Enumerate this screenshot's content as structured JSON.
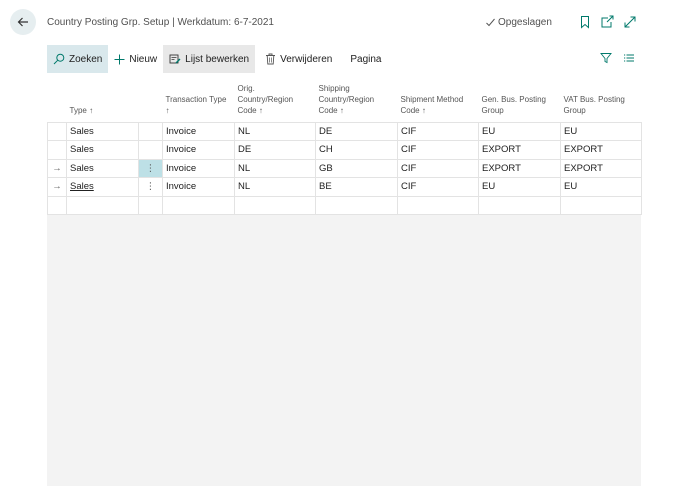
{
  "header": {
    "title": "Country Posting Grp. Setup | Werkdatum: 6-7-2021",
    "saved_label": "Opgeslagen"
  },
  "actions": {
    "search": "Zoeken",
    "new": "Nieuw",
    "edit_list": "Lijst bewerken",
    "delete": "Verwijderen",
    "page": "Pagina"
  },
  "columns": {
    "type": "Type ↑",
    "transaction_type": "Transaction Type ↑",
    "orig_country": "Orig. Country/Region Code ↑",
    "shipping_country": "Shipping Country/Region Code ↑",
    "shipment_method": "Shipment Method Code ↑",
    "gen_bus_posting": "Gen. Bus. Posting Group",
    "vat_bus_posting": "VAT Bus. Posting Group"
  },
  "rows": [
    {
      "indicator": "",
      "type": "Sales",
      "dots": "",
      "transaction_type": "Invoice",
      "orig_country": "NL",
      "shipping_country": "DE",
      "shipment_method": "CIF",
      "gen_bus_posting": "EU",
      "vat_bus_posting": "EU"
    },
    {
      "indicator": "",
      "type": "Sales",
      "dots": "",
      "transaction_type": "Invoice",
      "orig_country": "DE",
      "shipping_country": "CH",
      "shipment_method": "CIF",
      "gen_bus_posting": "EXPORT",
      "vat_bus_posting": "EXPORT"
    },
    {
      "indicator": "→",
      "type": "Sales",
      "dots": "⋮",
      "transaction_type": "Invoice",
      "orig_country": "NL",
      "shipping_country": "GB",
      "shipment_method": "CIF",
      "gen_bus_posting": "EXPORT",
      "vat_bus_posting": "EXPORT"
    },
    {
      "indicator": "→",
      "type": "Sales",
      "dots": "⋮",
      "transaction_type": "Invoice",
      "orig_country": "NL",
      "shipping_country": "BE",
      "shipment_method": "CIF",
      "gen_bus_posting": "EU",
      "vat_bus_posting": "EU"
    }
  ],
  "colors": {
    "accent": "#00796b",
    "selected_cell": "#bde0e6",
    "back_button": "#e6eef0"
  },
  "icons": {
    "back": "arrow-left-icon",
    "saved": "checkmark-icon",
    "bookmark": "bookmark-icon",
    "share": "share-icon",
    "expand": "expand-icon",
    "search": "search-icon",
    "new": "plus-icon",
    "edit_list": "edit-list-icon",
    "delete": "trash-icon",
    "filter": "filter-icon",
    "list": "list-view-icon"
  }
}
